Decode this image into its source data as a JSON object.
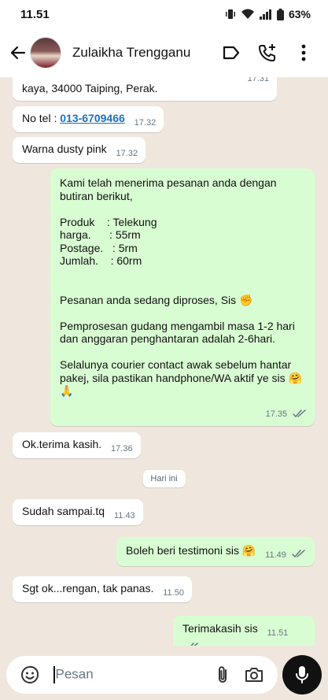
{
  "status": {
    "time": "11.51",
    "battery": "63%"
  },
  "header": {
    "contact_name": "Zulaikha Trengganu"
  },
  "messages": [
    {
      "dir": "in",
      "text": "kaya, 34000 Taiping, Perak.",
      "time": "17.31"
    },
    {
      "dir": "in",
      "prefix": "No tel : ",
      "link": "013-6709466",
      "time": "17.32"
    },
    {
      "dir": "in",
      "text": "Warna dusty pink",
      "time": "17.32"
    },
    {
      "dir": "out",
      "text": "Kami telah menerima pesanan anda dengan\nbutiran berikut,\n\nProduk    : Telekung\nharga.      : 55rm\nPostage.   : 5rm\nJumlah.    : 60rm\n\n\nPesanan anda sedang diproses, Sis ✊\n\nPemprosesan gudang mengambil masa 1-2 hari\ndan anggaran penghantaran adalah 2-6hari.\n\nSelalunya courier contact awak sebelum hantar\npakej, sila pastikan handphone/WA aktif ye sis 🤗\n🙏",
      "time": "17.35"
    },
    {
      "dir": "in",
      "text": "Ok.terima kasih.",
      "time": "17.36"
    },
    {
      "dir": "in",
      "text": "Sudah sampai.tq",
      "time": "11.43"
    },
    {
      "dir": "out",
      "text": "Boleh beri testimoni sis 🤗",
      "time": "11.49"
    },
    {
      "dir": "in",
      "text": "Sgt ok...rengan, tak panas.",
      "time": "11.50"
    },
    {
      "dir": "out",
      "text": "Terimakasih sis",
      "time": "11.51"
    }
  ],
  "date_chip": "Hari ini",
  "composer": {
    "placeholder": "Pesan"
  },
  "colors": {
    "chat_bg": "#efe7dd",
    "out_bubble": "#d9fdd3",
    "in_bubble": "#ffffff",
    "tick": "#667781"
  }
}
